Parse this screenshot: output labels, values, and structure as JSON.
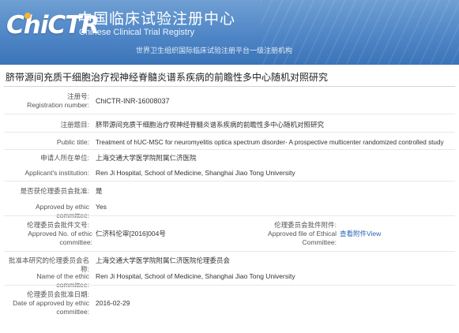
{
  "header": {
    "logo_text": "ChiCTR",
    "cn_title": "中国临床试验注册中心",
    "en_title": "Chinese Clinical Trial Registry",
    "subtitle": "世界卫生组织国际临床试验注册平台一级注册机构",
    "accent_color": "#f5b33a",
    "bg_color": "#4f86c6"
  },
  "study_title": "脐带源间充质干细胞治疗视神经脊髓炎谱系疾病的前瞻性多中心随机对照研究",
  "fields": {
    "registration_label_cn": "注册号:",
    "registration_label_en": "Registration number:",
    "registration_value": "ChiCTR-INR-16008037",
    "reg_title_label_cn": "注册题目:",
    "reg_title_value": "脐带源间充质干细胞治疗视神经脊髓炎谱系疾病的前瞻性多中心随机对照研究",
    "public_title_label": "Public title:",
    "public_title_value": "Treatment of hUC-MSC for neuromyelitis optica spectrum disorder- A prospective multicenter randomized controlled study",
    "applicant_inst_label_cn": "申请人所在单位:",
    "applicant_inst_value_cn": "上海交通大学医学院附属仁济医院",
    "applicant_inst_label_en": "Applicant's institution:",
    "applicant_inst_value_en": "Ren Ji Hospital, School of Medicine, Shanghai Jiao Tong University",
    "ethic_approved_label_cn": "是否获伦理委员会批准:",
    "ethic_approved_value_cn": "是",
    "ethic_approved_label_en": "Approved by ethic committee:",
    "ethic_approved_value_en": "Yes",
    "ethic_no_label_cn": "伦理委员会批件文号:",
    "ethic_no_label_en": "Approved No. of ethic committee:",
    "ethic_no_value": "仁济科伦审[2016]004号",
    "ethic_file_label_cn": "伦理委员会批件附件:",
    "ethic_file_label_en": "Approved file of Ethical Committee:",
    "ethic_file_value": "查看附件View",
    "ethic_name_label_cn": "批准本研究的伦理委员会名称:",
    "ethic_name_value_cn": "上海交通大学医学院附属仁济医院伦理委员会",
    "ethic_name_label_en": "Name of the ethic committee:",
    "ethic_name_value_en": "Ren Ji Hospital, School of Medicine, Shanghai Jiao Tong University",
    "ethic_date_label_cn": "伦理委员会批准日期:",
    "ethic_date_label_en": "Date of approved by ethic committee:",
    "ethic_date_value": "2016-02-29"
  }
}
